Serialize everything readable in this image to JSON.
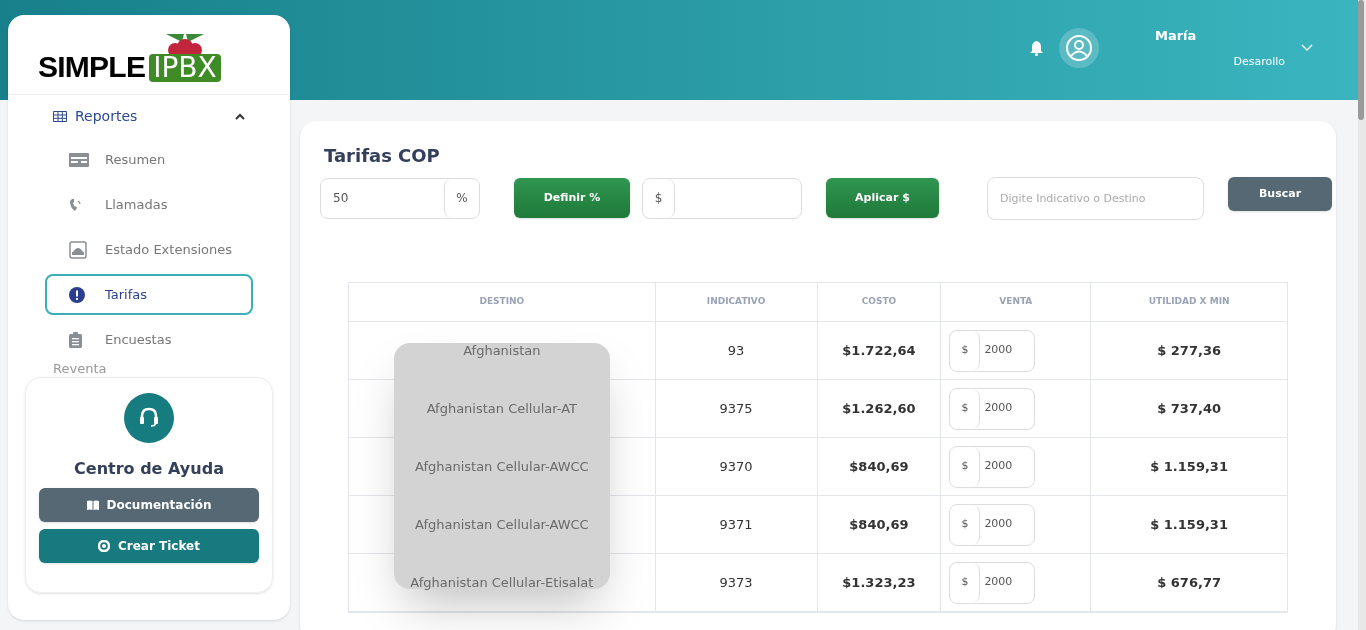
{
  "logo": {
    "word": "SIMPLE",
    "badge": "IPBX"
  },
  "header": {
    "user": {
      "name": "María",
      "role": "Desarollo"
    }
  },
  "sidebar": {
    "section": {
      "label": "Reportes",
      "expanded": true
    },
    "items": [
      {
        "label": "Resumen",
        "kind": "card",
        "selected": false
      },
      {
        "label": "Llamadas",
        "kind": "phone",
        "selected": false
      },
      {
        "label": "Estado Extensiones",
        "kind": "monitor",
        "selected": false
      },
      {
        "label": "Tarifas",
        "kind": "alert",
        "selected": true
      },
      {
        "label": "Encuestas",
        "kind": "clipboard",
        "selected": false
      }
    ],
    "next_section": {
      "label": "Reventa"
    }
  },
  "help": {
    "title": "Centro de Ayuda",
    "buttons": [
      {
        "label": "Documentación",
        "kind": "docs"
      },
      {
        "label": "Crear Ticket",
        "kind": "ticket"
      }
    ]
  },
  "page": {
    "title": "Tarifas COP",
    "percent_field": {
      "value": "50",
      "suffix": "%"
    },
    "percent_button": "Definir %",
    "amount_field": {
      "prefix": "$"
    },
    "amount_button": "Aplicar $",
    "search": {
      "placeholder": "Digite Indicativo o Destino"
    },
    "search_button": "Buscar"
  },
  "table": {
    "columns": [
      "DESTINO",
      "INDICATIVO",
      "COSTO",
      "VENTA",
      "UTILIDAD X MIN"
    ],
    "rows": [
      {
        "destino": "Afghanistan",
        "indicativo": "93",
        "costo": "$1.722,64",
        "currency": "$",
        "venta": "2000",
        "utilidad": "$ 277,36"
      },
      {
        "destino": "Afghanistan Cellular-AT",
        "indicativo": "9375",
        "costo": "$1.262,60",
        "currency": "$",
        "venta": "2000",
        "utilidad": "$ 737,40"
      },
      {
        "destino": "Afghanistan Cellular-AWCC",
        "indicativo": "9370",
        "costo": "$840,69",
        "currency": "$",
        "venta": "2000",
        "utilidad": "$ 1.159,31"
      },
      {
        "destino": "Afghanistan Cellular-AWCC",
        "indicativo": "9371",
        "costo": "$840,69",
        "currency": "$",
        "venta": "2000",
        "utilidad": "$ 1.159,31"
      },
      {
        "destino": "Afghanistan Cellular-Etisalat",
        "indicativo": "9373",
        "costo": "$1.323,23",
        "currency": "$",
        "venta": "2000",
        "utilidad": "$ 676,77"
      }
    ]
  }
}
